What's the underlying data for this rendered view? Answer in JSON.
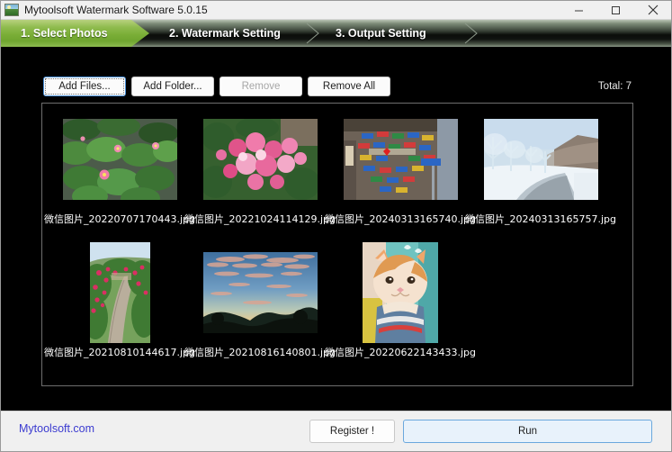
{
  "window": {
    "title": "Mytoolsoft Watermark Software 5.0.15",
    "icon": "photo-app-icon",
    "controls": {
      "minimize": "minimize-icon",
      "maximize": "maximize-icon",
      "close": "close-icon"
    }
  },
  "steps": [
    {
      "label": "1. Select Photos",
      "active": true
    },
    {
      "label": "2. Watermark Setting",
      "active": false
    },
    {
      "label": "3. Output Setting",
      "active": false
    }
  ],
  "toolbar": {
    "add_files": "Add Files...",
    "add_folder": "Add Folder...",
    "remove": "Remove",
    "remove_all": "Remove All",
    "total": "Total: 7"
  },
  "photos": [
    {
      "name": "微信图片_20220707170443.jpg",
      "thumb": "lotus-pond",
      "orientation": "landscape"
    },
    {
      "name": "微信图片_20221024114129.jpg",
      "thumb": "pink-roses",
      "orientation": "landscape"
    },
    {
      "name": "微信图片_20240313165740.jpg",
      "thumb": "wall-of-signs",
      "orientation": "landscape"
    },
    {
      "name": "微信图片_20240313165757.jpg",
      "thumb": "snowy-road",
      "orientation": "landscape"
    },
    {
      "name": "微信图片_20210810144617.jpg",
      "thumb": "garden-path",
      "orientation": "portrait"
    },
    {
      "name": "微信图片_20210816140801.jpg",
      "thumb": "sunset-sky",
      "orientation": "landscape"
    },
    {
      "name": "微信图片_20220622143433.jpg",
      "thumb": "orange-cat",
      "orientation": "portrait"
    }
  ],
  "footer": {
    "site": "Mytoolsoft.com",
    "register": "Register !",
    "run": "Run"
  },
  "colors": {
    "active_step": "#7aae37",
    "panel_bg": "#000000",
    "link": "#3b3bd0",
    "run_border": "#6aa8dd",
    "run_fill": "#e8f2fb"
  }
}
